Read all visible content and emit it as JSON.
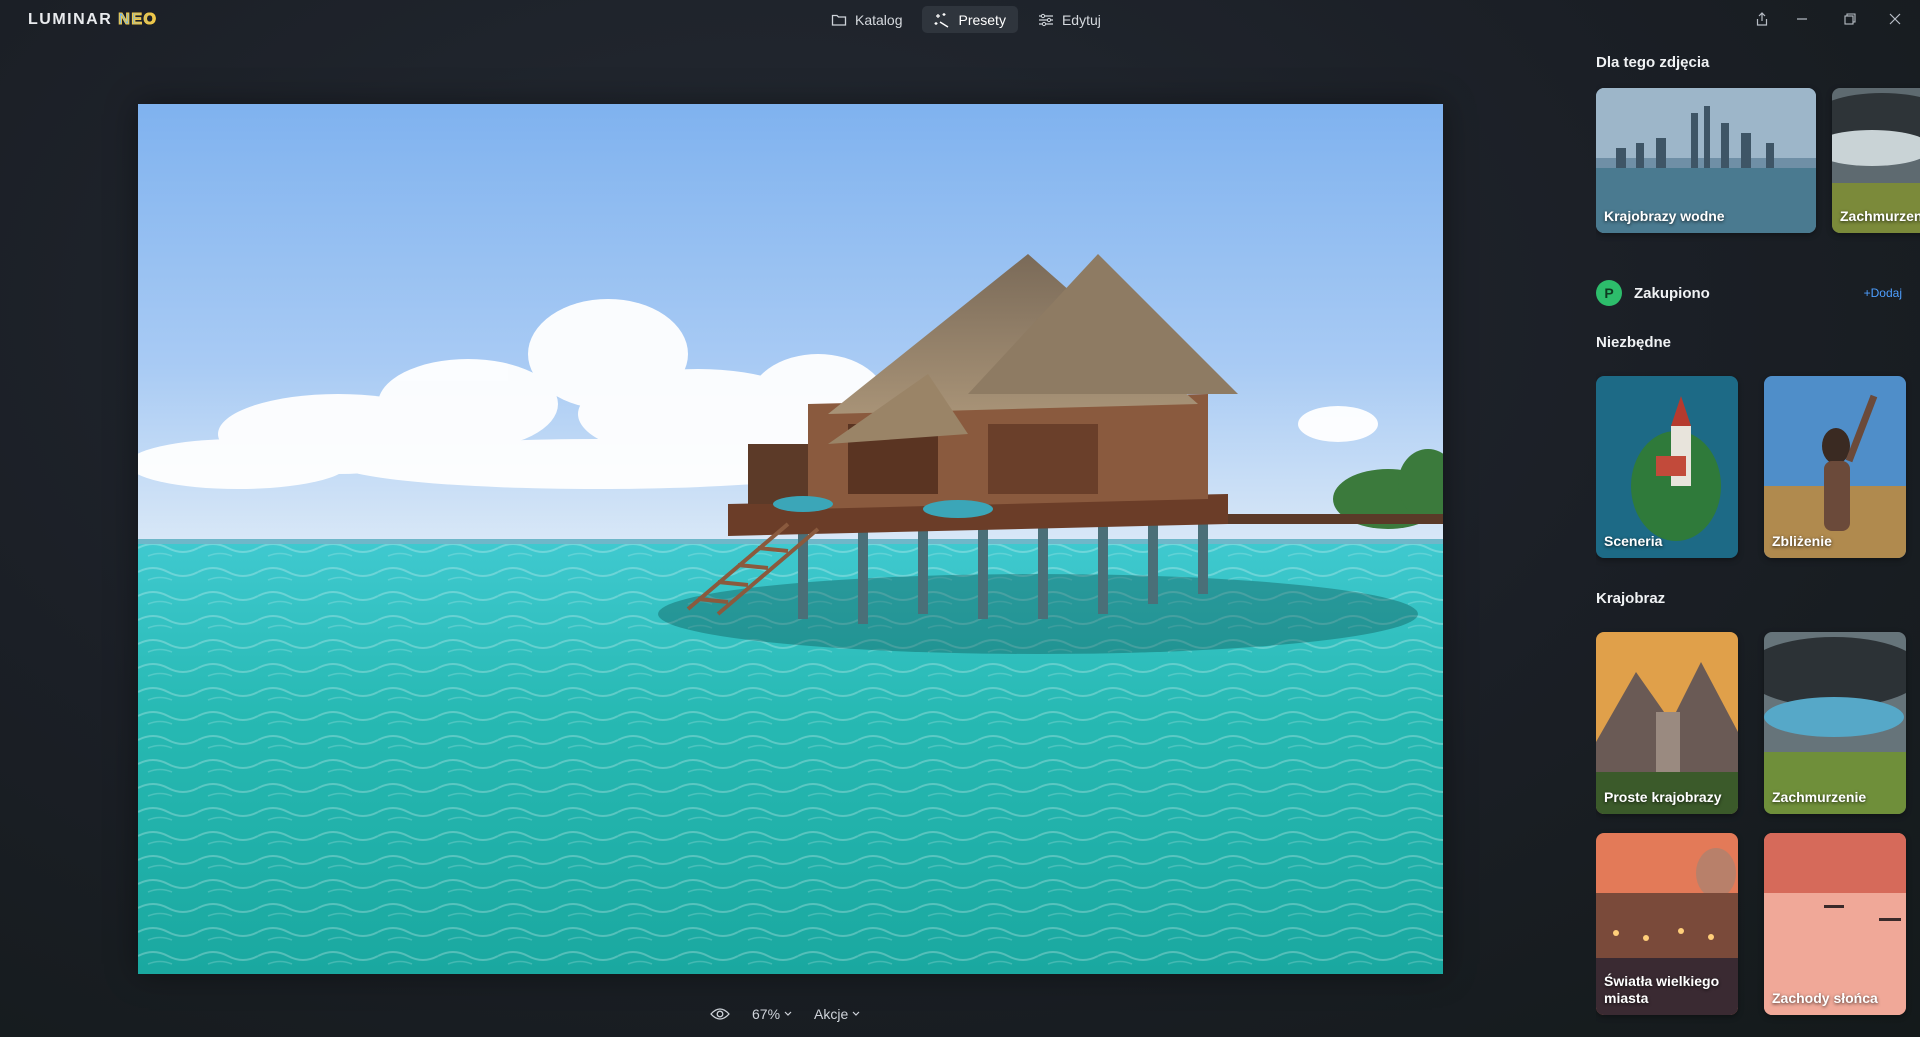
{
  "app": {
    "logo_main": "LUMINAR",
    "logo_suffix": "NEO"
  },
  "tabs": [
    {
      "label": "Katalog",
      "icon": "folder-icon"
    },
    {
      "label": "Presety",
      "icon": "sparkle-wand-icon",
      "active": true
    },
    {
      "label": "Edytuj",
      "icon": "sliders-icon"
    }
  ],
  "window_controls": [
    "share-icon",
    "minimize-icon",
    "restore-icon",
    "close-icon"
  ],
  "bottom": {
    "zoom": "67%",
    "actions": "Akcje"
  },
  "panel": {
    "for_photo_title": "Dla tego zdjęcia",
    "for_photo_cards": [
      "Krajobrazy wodne",
      "Zachmurzenie"
    ],
    "purchased": {
      "title": "Zakupiono",
      "add_label": "+Dodaj",
      "badge_letter": "P"
    },
    "essentials_title": "Niezbędne",
    "essentials_cards": [
      "Sceneria",
      "Zbliżenie"
    ],
    "landscape_title": "Krajobraz",
    "landscape_cards": [
      "Proste krajobrazy",
      "Zachmurzenie",
      "Światła wielkiego miasta",
      "Zachody słońca"
    ]
  },
  "colors": {
    "accent_blue": "#4d9fff",
    "purchased_green": "#2dbd6b",
    "active_tab": "#2f353d"
  }
}
